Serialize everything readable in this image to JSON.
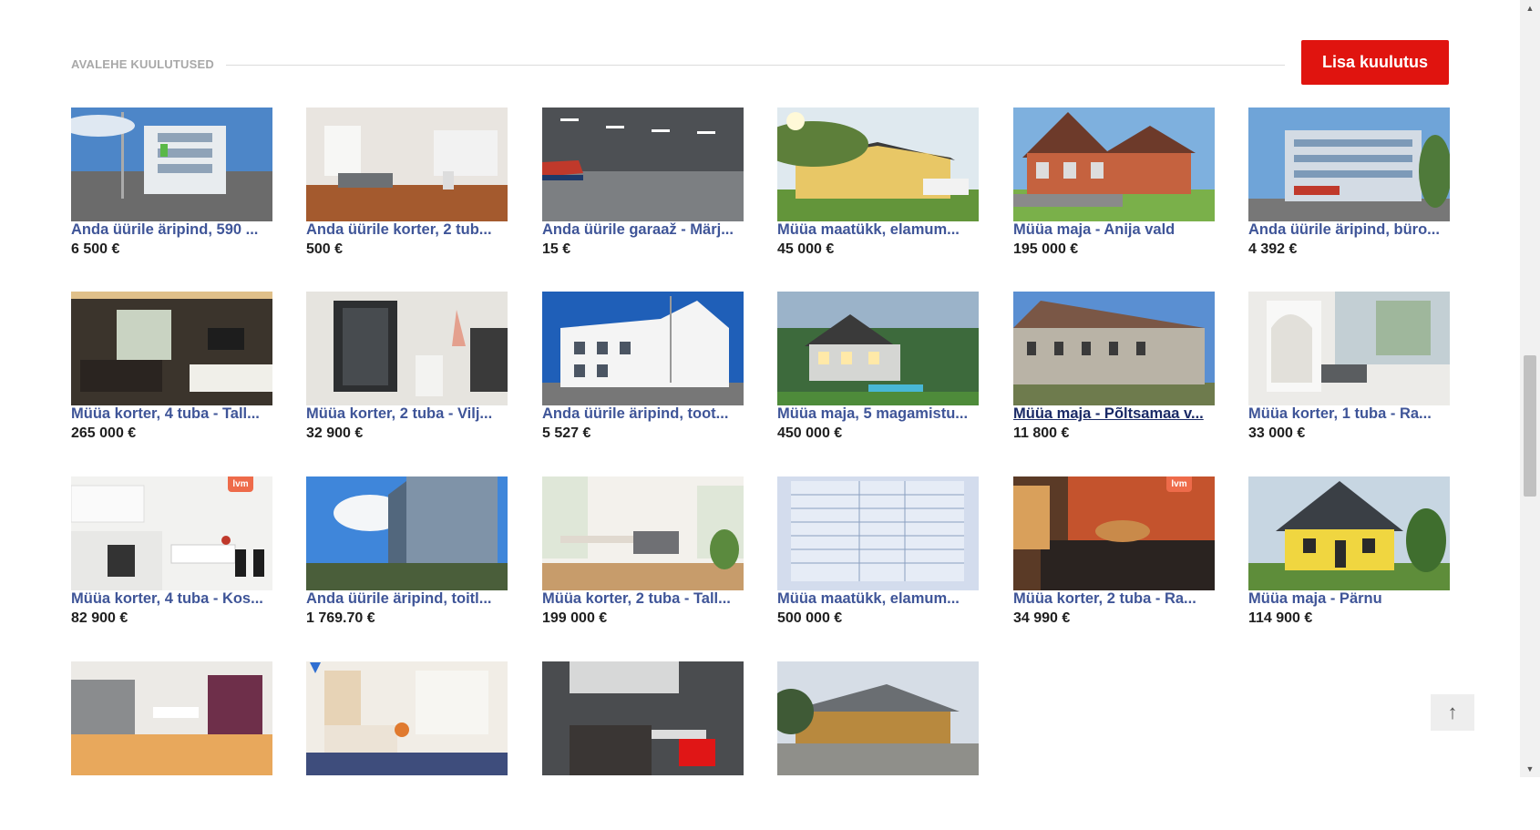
{
  "section": {
    "title": "AVALEHE KUULUTUSED",
    "add_button_label": "Lisa kuulutus"
  },
  "listings": [
    {
      "title": "Anda üürile äripind, 590 ...",
      "price": "6 500 €"
    },
    {
      "title": "Anda üürile korter, 2 tub...",
      "price": "500 €"
    },
    {
      "title": "Anda üürile garaaž - Märj...",
      "price": "15 €"
    },
    {
      "title": "Müüa maatükk, elamum...",
      "price": "45 000 €"
    },
    {
      "title": "Müüa maja - Anija vald",
      "price": "195 000 €"
    },
    {
      "title": "Anda üürile äripind, büro...",
      "price": "4 392 €"
    },
    {
      "title": "Müüa korter, 4 tuba - Tall...",
      "price": "265 000 €"
    },
    {
      "title": "Müüa korter, 2 tuba - Vilj...",
      "price": "32 900 €"
    },
    {
      "title": "Anda üürile äripind, toot...",
      "price": "5 527 €"
    },
    {
      "title": "Müüa maja, 5 magamistu...",
      "price": "450 000 €"
    },
    {
      "title": "Müüa maja - Põltsamaa v...",
      "price": "11 800 €"
    },
    {
      "title": "Müüa korter, 1 tuba - Ra...",
      "price": "33 000 €"
    },
    {
      "title": "Müüa korter, 4 tuba - Kos...",
      "price": "82 900 €"
    },
    {
      "title": "Anda üürile äripind, toitl...",
      "price": "1 769.70 €"
    },
    {
      "title": "Müüa korter, 2 tuba - Tall...",
      "price": "199 000 €"
    },
    {
      "title": "Müüa maatükk, elamum...",
      "price": "500 000 €"
    },
    {
      "title": "Müüa korter, 2 tuba - Ra...",
      "price": "34 990 €"
    },
    {
      "title": "Müüa maja - Pärnu",
      "price": "114 900 €"
    },
    {
      "title": "",
      "price": ""
    },
    {
      "title": "",
      "price": ""
    },
    {
      "title": "",
      "price": ""
    },
    {
      "title": "",
      "price": ""
    }
  ],
  "badges": {
    "brand_label": "lvm"
  },
  "scroll_top_label": "↑",
  "scrollbar": {
    "up": "▲",
    "down": "▼"
  },
  "colors": {
    "accent": "#e0140f",
    "link": "#3f5598",
    "price": "#1f1f1f",
    "muted": "#a8a8a8"
  }
}
